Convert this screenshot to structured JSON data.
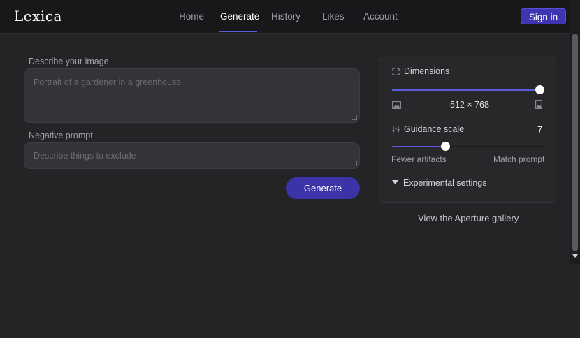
{
  "app": {
    "logo": "Lexica"
  },
  "nav": {
    "items": [
      {
        "label": "Home",
        "active": false
      },
      {
        "label": "Generate",
        "active": true
      },
      {
        "label": "History",
        "active": false
      },
      {
        "label": "Likes",
        "active": false
      },
      {
        "label": "Account",
        "active": false
      }
    ],
    "signin_label": "Sign in"
  },
  "form": {
    "prompt_label": "Describe your image",
    "prompt_placeholder": "Portrait of a gardener in a greenhouse",
    "negative_label": "Negative prompt",
    "negative_placeholder": "Describe things to exclude",
    "generate_label": "Generate"
  },
  "settings": {
    "dimensions_label": "Dimensions",
    "dimensions_value": "512 × 768",
    "dimensions_slider_fraction": 1.0,
    "guidance_label": "Guidance scale",
    "guidance_value": "7",
    "guidance_slider_fraction": 0.35,
    "guidance_min_label": "Fewer artifacts",
    "guidance_max_label": "Match prompt",
    "experimental_label": "Experimental settings"
  },
  "gallery_link": "View the Aperture gallery",
  "colors": {
    "accent": "#5b5bd6",
    "button": "#3b33a8",
    "background": "#242426"
  },
  "icons": {
    "dimensions": "expand-icon",
    "landscape": "landscape-image-icon",
    "portrait": "portrait-image-icon",
    "guidance": "sliders-icon",
    "experimental": "caret-down-icon"
  }
}
